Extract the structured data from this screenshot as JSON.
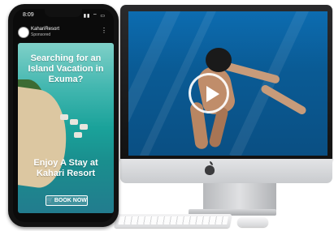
{
  "phone": {
    "status": {
      "time": "8:09",
      "icons": "▮▮ ⌔ ▭"
    },
    "post": {
      "account": "KahariResort",
      "sponsored": "Sponsored",
      "more": "⋮"
    },
    "ad": {
      "headline": "Searching for  an Island Vacation in Exuma?",
      "cta_text": "Enjoy A Stay at Kahari Resort",
      "button_label": "BOOK NOW",
      "button_icon": "🛒"
    }
  },
  "imac": {
    "video": {
      "play_icon": "play-icon"
    }
  }
}
